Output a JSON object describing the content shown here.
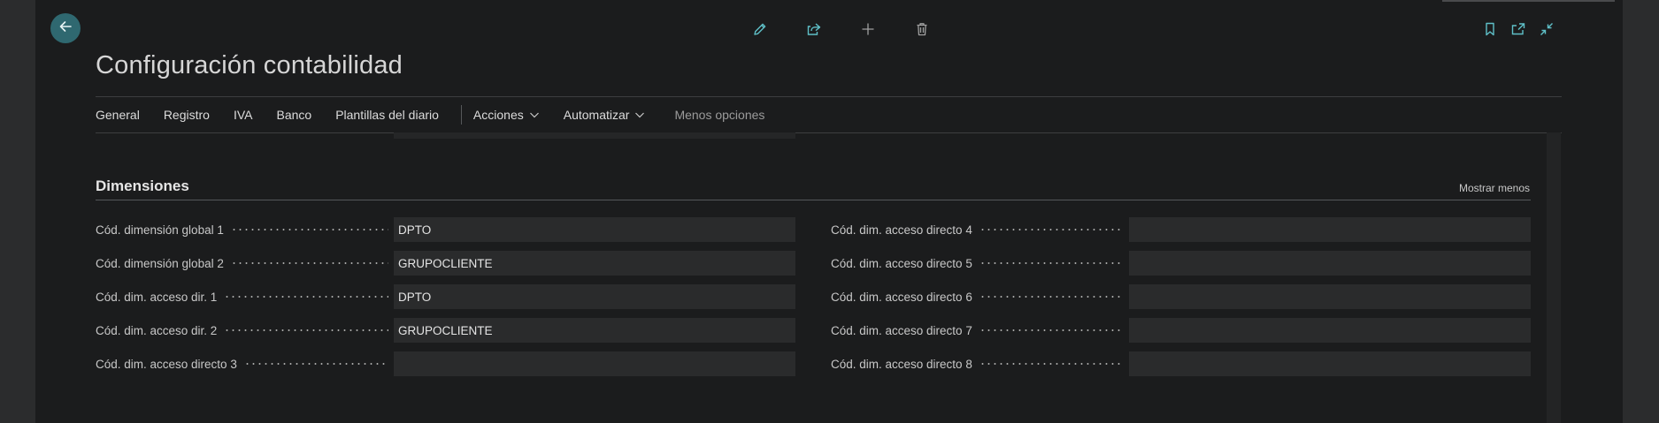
{
  "page": {
    "title": "Configuración contabilidad"
  },
  "toolbar": {
    "edit_icon": "pencil-icon",
    "share_icon": "share-icon",
    "new_icon": "plus-icon",
    "delete_icon": "trash-icon",
    "bookmark_icon": "bookmark-icon",
    "open_new_window_icon": "open-in-new-window-icon",
    "collapse_icon": "collapse-icon"
  },
  "nav": {
    "items": [
      "General",
      "Registro",
      "IVA",
      "Banco",
      "Plantillas del diario"
    ],
    "actions": "Acciones",
    "automate": "Automatizar",
    "less_options": "Menos opciones"
  },
  "section": {
    "title": "Dimensiones",
    "toggle": "Mostrar menos"
  },
  "fields_left": [
    {
      "label": "Cód. dimensión global 1",
      "value": "DPTO"
    },
    {
      "label": "Cód. dimensión global 2",
      "value": "GRUPOCLIENTE"
    },
    {
      "label": "Cód. dim. acceso dir. 1",
      "value": "DPTO"
    },
    {
      "label": "Cód. dim. acceso dir. 2",
      "value": "GRUPOCLIENTE"
    },
    {
      "label": "Cód. dim. acceso directo 3",
      "value": ""
    }
  ],
  "fields_right": [
    {
      "label": "Cód. dim. acceso directo 4",
      "value": ""
    },
    {
      "label": "Cód. dim. acceso directo 5",
      "value": ""
    },
    {
      "label": "Cód. dim. acceso directo 6",
      "value": ""
    },
    {
      "label": "Cód. dim. acceso directo 7",
      "value": ""
    },
    {
      "label": "Cód. dim. acceso directo 8",
      "value": ""
    }
  ],
  "colors": {
    "background": "#1b1c1d",
    "accent": "#2f6870",
    "icon": "#5fc0c8",
    "field": "#2a2b2c"
  }
}
